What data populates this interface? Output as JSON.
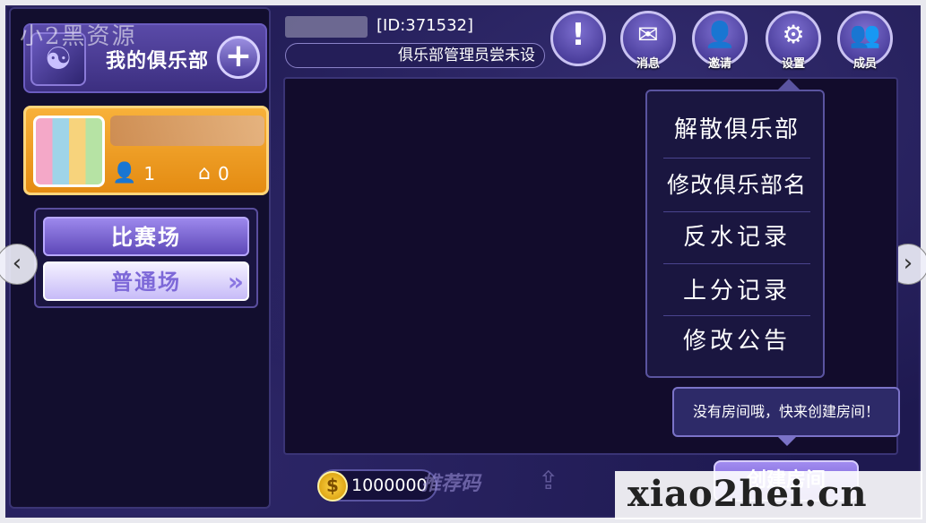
{
  "left_panel": {
    "club_title": "我的俱乐部",
    "add_symbol": "+",
    "watermark_top": "小2黑资源",
    "card": {
      "members_count": "1",
      "rooms_count": "0"
    },
    "modes": {
      "contest_label": "比赛场",
      "normal_label": "普通场",
      "normal_chevron": "»"
    }
  },
  "nav": {
    "left_arrow": "‹",
    "right_arrow": "›"
  },
  "header": {
    "user_id": "[ID:371532]",
    "notice": "俱乐部管理员尝未设",
    "icons": [
      {
        "name": "alert-icon",
        "glyph": "!",
        "label": ""
      },
      {
        "name": "message-icon",
        "glyph": "✉",
        "label": "消息"
      },
      {
        "name": "invite-icon",
        "glyph": "👤",
        "label": "邀请"
      },
      {
        "name": "settings-icon",
        "glyph": "⚙",
        "label": "设置"
      },
      {
        "name": "members-icon",
        "glyph": "👥",
        "label": "成员"
      }
    ]
  },
  "dropdown": {
    "items": [
      "解散俱乐部",
      "修改俱乐部名",
      "反水记录",
      "上分记录",
      "修改公告"
    ]
  },
  "tooltip": {
    "text": "没有房间哦，快来创建房间！"
  },
  "bottom": {
    "coin_symbol": "$",
    "gold": "1000000",
    "recommend_label": "推荐码",
    "create_label": "创建房间"
  },
  "watermark": {
    "text": "xiao2hei.cn"
  }
}
